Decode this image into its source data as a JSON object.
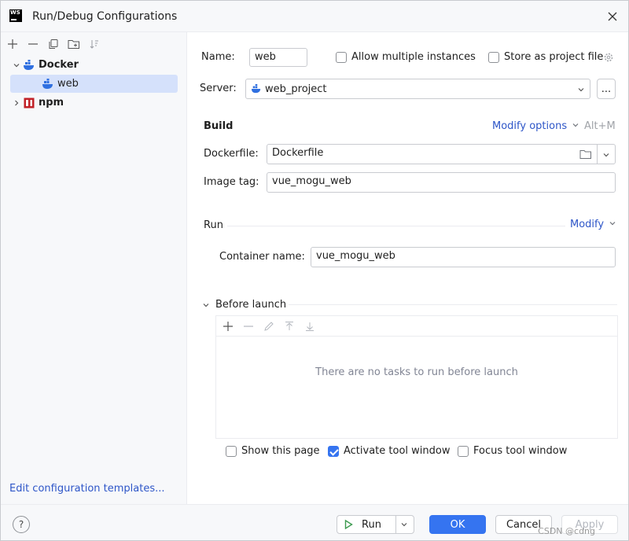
{
  "window": {
    "title": "Run/Debug Configurations",
    "app_logo": "WS"
  },
  "left_toolbar": {
    "icons": [
      "add-icon",
      "remove-icon",
      "copy-icon",
      "new-folder-icon",
      "sort-icon"
    ]
  },
  "tree": {
    "docker": {
      "label": "Docker",
      "icon": "docker-icon"
    },
    "web": {
      "label": "web",
      "icon": "docker-icon"
    },
    "npm": {
      "label": "npm",
      "icon": "npm-icon"
    }
  },
  "edit_templates_link": "Edit configuration templates...",
  "form": {
    "name_label": "Name:",
    "name_value": "web",
    "allow_multiple_label": "Allow multiple instances",
    "store_as_project_label": "Store as project file",
    "server_label": "Server:",
    "server_value": "web_project",
    "server_more": "...",
    "build_title": "Build",
    "modify_options_link": "Modify options",
    "modify_options_shortcut": "Alt+M",
    "dockerfile_label": "Dockerfile:",
    "dockerfile_value": "Dockerfile",
    "image_tag_label": "Image tag:",
    "image_tag_value": "vue_mogu_web",
    "run_title": "Run",
    "modify_link": "Modify",
    "container_name_label": "Container name:",
    "container_name_value": "vue_mogu_web",
    "before_launch_title": "Before launch",
    "before_launch_empty": "There are no tasks to run before launch",
    "show_page_label": "Show this page",
    "activate_tool_label": "Activate tool window",
    "focus_tool_label": "Focus tool window",
    "show_page_checked": false,
    "activate_tool_checked": true,
    "focus_tool_checked": false
  },
  "bottom": {
    "help": "?",
    "run_label": "Run",
    "ok_label": "OK",
    "cancel_label": "Cancel",
    "apply_label": "Apply",
    "watermark": "CSDN @cdng"
  },
  "colors": {
    "accent": "#3574f0",
    "link": "#2e56c8",
    "docker": "#2f6fe0",
    "npm": "#c12127",
    "selection": "#d5e1fb"
  }
}
